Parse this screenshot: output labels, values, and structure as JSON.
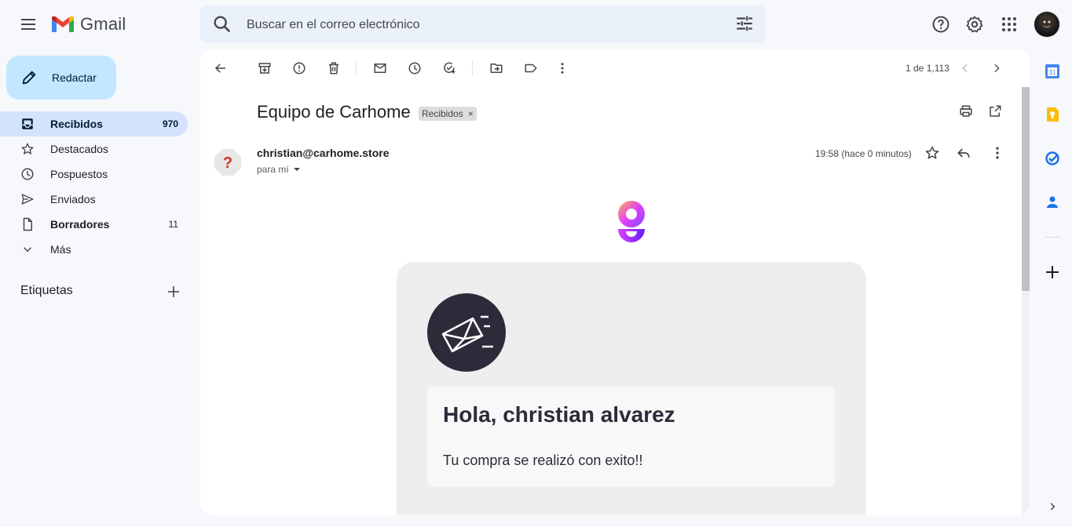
{
  "header": {
    "app_name": "Gmail",
    "search_placeholder": "Buscar en el correo electrónico"
  },
  "sidebar": {
    "compose_label": "Redactar",
    "items": [
      {
        "label": "Recibidos",
        "count": "970",
        "icon": "inbox-icon",
        "active": true,
        "bold": true
      },
      {
        "label": "Destacados",
        "count": "",
        "icon": "star-icon",
        "active": false,
        "bold": false
      },
      {
        "label": "Pospuestos",
        "count": "",
        "icon": "clock-icon",
        "active": false,
        "bold": false
      },
      {
        "label": "Enviados",
        "count": "",
        "icon": "send-icon",
        "active": false,
        "bold": false
      },
      {
        "label": "Borradores",
        "count": "11",
        "icon": "draft-icon",
        "active": false,
        "bold": true
      },
      {
        "label": "Más",
        "count": "",
        "icon": "chevron-down-icon",
        "active": false,
        "bold": false
      }
    ],
    "labels_heading": "Etiquetas"
  },
  "toolbar": {
    "pager": "1 de 1,113"
  },
  "message": {
    "subject": "Equipo de Carhome",
    "label_chip": "Recibidos",
    "label_chip_close": "×",
    "sender_email": "christian@carhome.store",
    "recipient": "para mí",
    "time": "19:58 (hace 0 minutos)",
    "sender_avatar_glyph": "?"
  },
  "email_body": {
    "greeting": "Hola, christian alvarez",
    "text": "Tu compra se realizó con exito!!"
  },
  "side_panel": {
    "calendar_day": "31",
    "apps": [
      "calendar-icon",
      "keep-icon",
      "tasks-icon",
      "contacts-icon"
    ]
  },
  "colors": {
    "accent": "#c2e7ff",
    "active_nav": "#d3e3fd",
    "background": "#f6f8fc",
    "card_dark": "#2b2b3a"
  }
}
